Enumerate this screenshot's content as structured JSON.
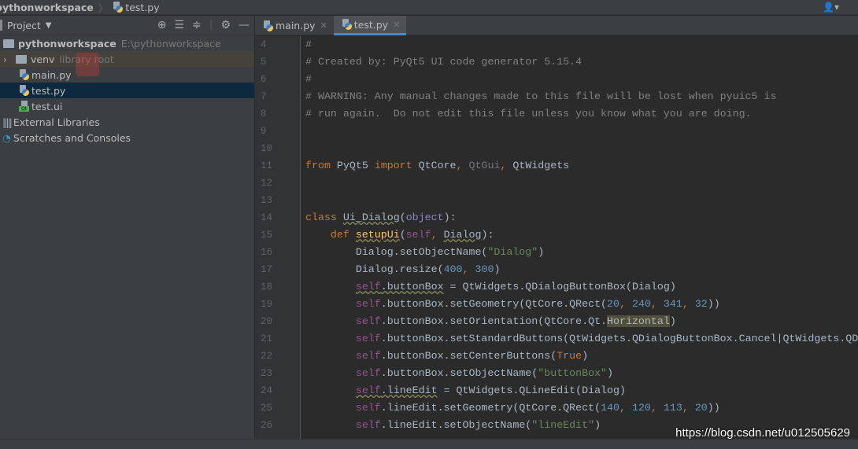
{
  "breadcrumb": {
    "project": "pythonworkspace",
    "file": "test.py"
  },
  "sidebar": {
    "title": "Project",
    "tree": [
      {
        "label": "pythonworkspace",
        "extra": "E:\\pythonworkspace",
        "icon": "folder-icon"
      },
      {
        "label": "venv",
        "extra": "library root",
        "icon": "folder-icon"
      },
      {
        "label": "main.py",
        "icon": "python-file-icon"
      },
      {
        "label": "test.py",
        "icon": "python-file-icon"
      },
      {
        "label": "test.ui",
        "icon": "qt-ui-file-icon"
      },
      {
        "label": "External Libraries",
        "icon": "libraries-icon"
      },
      {
        "label": "Scratches and Consoles",
        "icon": "scratches-icon"
      }
    ]
  },
  "tabs": [
    {
      "label": "main.py",
      "active": false
    },
    {
      "label": "test.py",
      "active": true
    }
  ],
  "editor": {
    "line_numbers": [
      "4",
      "5",
      "6",
      "7",
      "8",
      "9",
      "10",
      "11",
      "12",
      "13",
      "14",
      "15",
      "16",
      "17",
      "18",
      "19",
      "20",
      "21",
      "22",
      "23",
      "24",
      "25",
      "26"
    ],
    "lines": [
      [
        [
          "c",
          "#"
        ]
      ],
      [
        [
          "c",
          "# Created by: PyQt5 UI code generator 5.15.4"
        ]
      ],
      [
        [
          "c",
          "#"
        ]
      ],
      [
        [
          "c",
          "# WARNING: Any manual changes made to this file will be lost when pyuic5 is"
        ]
      ],
      [
        [
          "c",
          "# run again.  Do not edit this file unless you know what you are doing."
        ]
      ],
      [],
      [],
      [
        [
          "k",
          "from "
        ],
        [
          "d",
          "PyQt5 "
        ],
        [
          "k",
          "import "
        ],
        [
          "d",
          "QtCore"
        ],
        [
          "k",
          ", "
        ],
        [
          "g",
          "QtGui"
        ],
        [
          "k",
          ", "
        ],
        [
          "d",
          "QtWidgets"
        ]
      ],
      [],
      [],
      [
        [
          "k",
          "class "
        ],
        [
          "d u",
          "Ui_Dialog"
        ],
        [
          "d",
          "("
        ],
        [
          "b",
          "object"
        ],
        [
          "d",
          "):"
        ]
      ],
      [
        [
          "d",
          "    "
        ],
        [
          "k",
          "def "
        ],
        [
          "f u",
          "setupUi"
        ],
        [
          "d",
          "("
        ],
        [
          "s",
          "self"
        ],
        [
          "k",
          ", "
        ],
        [
          "d u",
          "Dialog"
        ],
        [
          "d",
          "):"
        ]
      ],
      [
        [
          "d",
          "        Dialog.setObjectName("
        ],
        [
          "st",
          "\"Dialog\""
        ],
        [
          "d",
          ")"
        ]
      ],
      [
        [
          "d",
          "        Dialog.resize("
        ],
        [
          "n",
          "400"
        ],
        [
          "k",
          ", "
        ],
        [
          "n",
          "300"
        ],
        [
          "d",
          ")"
        ]
      ],
      [
        [
          "d",
          "        "
        ],
        [
          "s u",
          "self"
        ],
        [
          "d u",
          ".buttonBox"
        ],
        [
          "d",
          " = QtWidgets.QDialogButtonBox(Dialog)"
        ]
      ],
      [
        [
          "d",
          "        "
        ],
        [
          "s",
          "self"
        ],
        [
          "d",
          ".buttonBox.setGeometry(QtCore.QRect("
        ],
        [
          "n",
          "20"
        ],
        [
          "k",
          ", "
        ],
        [
          "n",
          "240"
        ],
        [
          "k",
          ", "
        ],
        [
          "n",
          "341"
        ],
        [
          "k",
          ", "
        ],
        [
          "n",
          "32"
        ],
        [
          "d",
          "))"
        ]
      ],
      [
        [
          "d",
          "        "
        ],
        [
          "s",
          "self"
        ],
        [
          "d",
          ".buttonBox.setOrientation(QtCore.Qt."
        ],
        [
          "d h",
          "Horizontal"
        ],
        [
          "d",
          ")"
        ]
      ],
      [
        [
          "d",
          "        "
        ],
        [
          "s",
          "self"
        ],
        [
          "d",
          ".buttonBox.setStandardButtons(QtWidgets.QDialogButtonBox.Cancel|QtWidgets.QDialogButtonBox.Ok)"
        ]
      ],
      [
        [
          "d",
          "        "
        ],
        [
          "s",
          "self"
        ],
        [
          "d",
          ".buttonBox.setCenterButtons("
        ],
        [
          "k",
          "True"
        ],
        [
          "d",
          ")"
        ]
      ],
      [
        [
          "d",
          "        "
        ],
        [
          "s",
          "self"
        ],
        [
          "d",
          ".buttonBox.setObjectName("
        ],
        [
          "st",
          "\"buttonBox\""
        ],
        [
          "d",
          ")"
        ]
      ],
      [
        [
          "d",
          "        "
        ],
        [
          "s u",
          "self"
        ],
        [
          "d u",
          ".lineEdit"
        ],
        [
          "d",
          " = QtWidgets.QLineEdit(Dialog)"
        ]
      ],
      [
        [
          "d",
          "        "
        ],
        [
          "s",
          "self"
        ],
        [
          "d",
          ".lineEdit.setGeometry(QtCore.QRect("
        ],
        [
          "n",
          "140"
        ],
        [
          "k",
          ", "
        ],
        [
          "n",
          "120"
        ],
        [
          "k",
          ", "
        ],
        [
          "n",
          "113"
        ],
        [
          "k",
          ", "
        ],
        [
          "n",
          "20"
        ],
        [
          "d",
          "))"
        ]
      ],
      [
        [
          "d",
          "        "
        ],
        [
          "s",
          "self"
        ],
        [
          "d",
          ".lineEdit.setObjectName("
        ],
        [
          "st",
          "\"lineEdit\""
        ],
        [
          "d",
          ")"
        ]
      ]
    ]
  },
  "watermark": "https://blog.csdn.net/u012505629",
  "colors": {
    "background": "#2b2b2b",
    "sidebar": "#3c3f41",
    "selection": "#0d293e",
    "accent": "#4a88c7"
  }
}
